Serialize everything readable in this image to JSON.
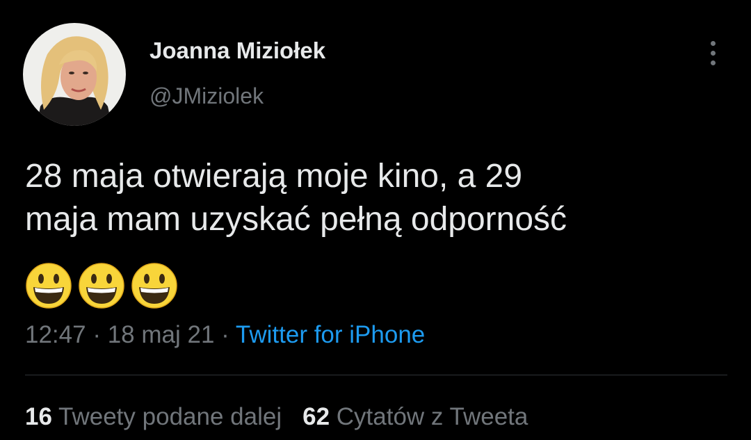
{
  "author": {
    "display_name": "Joanna Miziołek",
    "handle": "@JMiziolek"
  },
  "tweet": {
    "text_lines": [
      "28 maja otwierają moje kino, a 29",
      "maja mam uzyskać pełną odporność"
    ],
    "emojis": [
      "smiling-face-with-open-mouth",
      "smiling-face-with-open-mouth",
      "smiling-face-with-open-mouth"
    ]
  },
  "meta": {
    "time": "12:47",
    "separator": " · ",
    "date": "18 maj 21",
    "source": "Twitter for iPhone"
  },
  "stats": {
    "retweets_count": "16",
    "retweets_label": "Tweety podane dalej",
    "quotes_count": "62",
    "quotes_label": "Cytatów z Tweeta"
  },
  "colors": {
    "background": "#000000",
    "text_primary": "#e7e9ea",
    "text_secondary": "#71767b",
    "link": "#1d9bf0",
    "divider": "#2f3336"
  }
}
